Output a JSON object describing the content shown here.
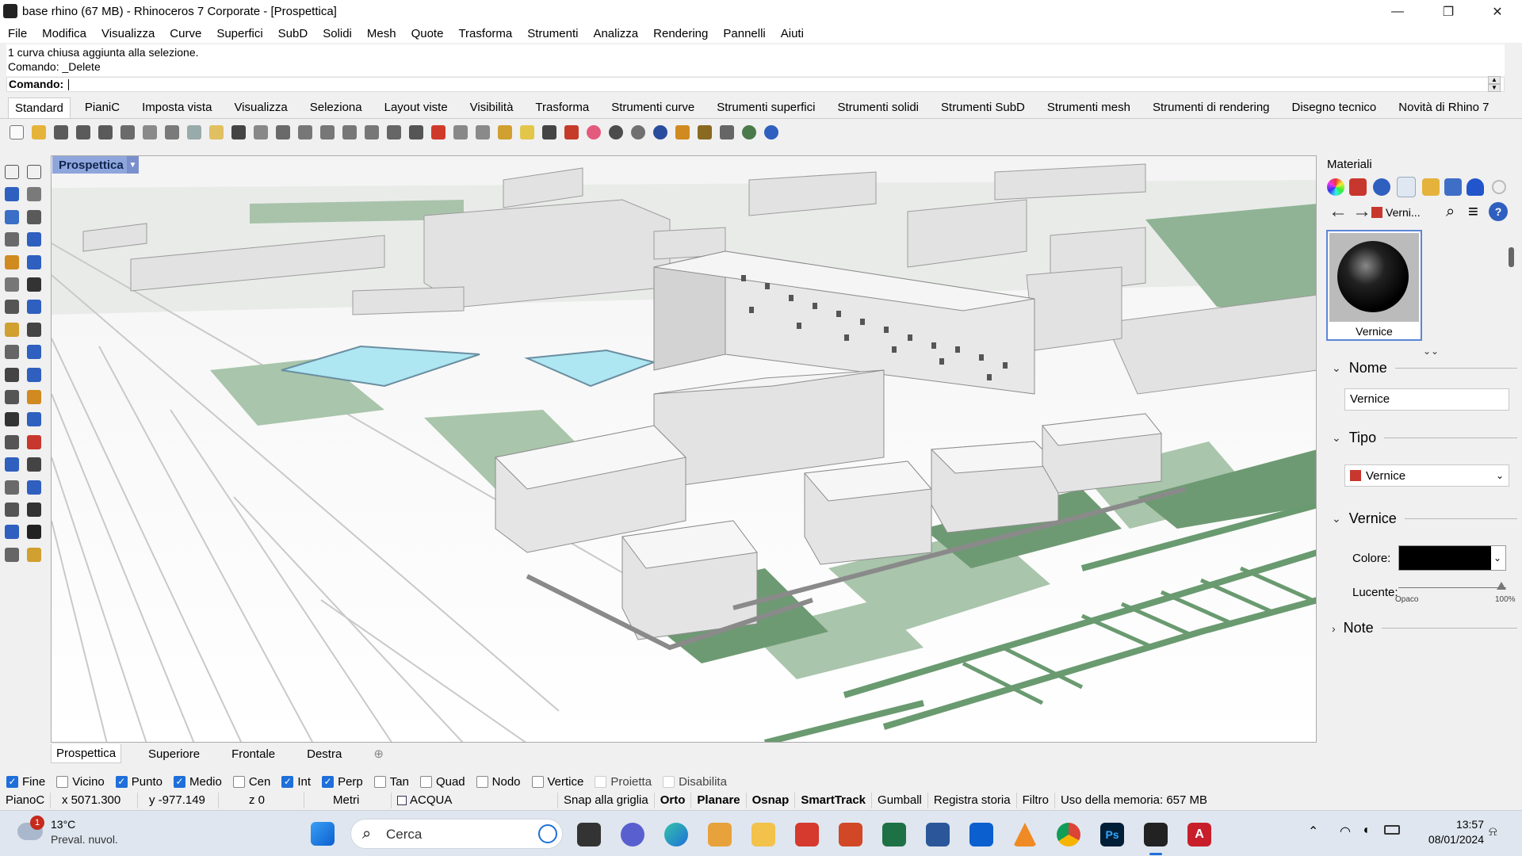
{
  "window": {
    "title": "base rhino (67 MB) - Rhinoceros 7 Corporate - [Prospettica]",
    "controls": {
      "minimize": "—",
      "maximize": "❐",
      "close": "✕"
    }
  },
  "menu": [
    "File",
    "Modifica",
    "Visualizza",
    "Curve",
    "Superfici",
    "SubD",
    "Solidi",
    "Mesh",
    "Quote",
    "Trasforma",
    "Strumenti",
    "Analizza",
    "Rendering",
    "Pannelli",
    "Aiuti"
  ],
  "command": {
    "history": [
      "1 curva chiusa aggiunta alla selezione.",
      "Comando: _Delete"
    ],
    "prompt": "Comando:"
  },
  "toolbar_tabs": [
    "Standard",
    "PianiC",
    "Imposta vista",
    "Visualizza",
    "Seleziona",
    "Layout viste",
    "Visibilità",
    "Trasforma",
    "Strumenti curve",
    "Strumenti superfici",
    "Strumenti solidi",
    "Strumenti SubD",
    "Strumenti mesh",
    "Strumenti di rendering",
    "Disegno tecnico",
    "Novità di Rhino 7"
  ],
  "toolbar_icons": [
    "new-icon",
    "open-icon",
    "save-icon",
    "save-as-icon",
    "save-small-icon",
    "print-icon",
    "copy-page-icon",
    "cut-icon",
    "copy-icon",
    "paste-icon",
    "undo-icon",
    "pan-icon",
    "move-view-icon",
    "zoom-icon",
    "zoom-window-icon",
    "zoom-extents-icon",
    "zoom-selected-icon",
    "rotate-view-icon",
    "four-views-icon",
    "car-icon",
    "camera-icon",
    "circle-icon",
    "grid-snap-icon",
    "light-icon",
    "lock-icon",
    "material-icon",
    "color-wheel-icon",
    "sphere-shaded-icon",
    "sphere-rendered-icon",
    "sphere-blue-icon",
    "tools-icon",
    "gear-options-icon",
    "transform-icon",
    "globe-icon",
    "help-icon"
  ],
  "toolbar_colors": [
    "#fafafa",
    "#e6b33a",
    "#5a5a5a",
    "#5a5a5a",
    "#5a5a5a",
    "#6b6b6b",
    "#8a8a8a",
    "#7a7a7a",
    "#9aa",
    "#e0c060",
    "#444",
    "#888",
    "#6a6a6a",
    "#777",
    "#777",
    "#777",
    "#777",
    "#666",
    "#555",
    "#d03a2a",
    "#888",
    "#8a8a8a",
    "#d0a030",
    "#e2c64a",
    "#444",
    "#c63a2a",
    "#e45a7c",
    "#4c4c4c",
    "#707070",
    "#2a4c9c",
    "#d08a20",
    "#8a6a20",
    "#666",
    "#4a7a4a",
    "#2f5fbf"
  ],
  "left_tools": [
    "select-icon",
    "point-icon",
    "polyline-icon",
    "curve-icon",
    "circle-tool-icon",
    "ellipse-icon",
    "polygon-icon",
    "rectangle-icon",
    "arc-icon",
    "fillet-icon",
    "surface-icon",
    "extrude-icon",
    "box-icon",
    "boolean-icon",
    "cylinder-icon",
    "cap-icon",
    "mesh-icon",
    "light-tool-icon",
    "transform-tool-icon",
    "align-icon",
    "analyze-icon",
    "group-icon",
    "fillet-curve-icon",
    "offset-icon",
    "text-icon",
    "dimension-icon",
    "block-icon",
    "edit-icon",
    "render-icon",
    "section-icon",
    "array-icon",
    "block-edit-icon",
    "scale-icon",
    "check-icon",
    "material-tool-icon",
    "paint-icon"
  ],
  "viewport": {
    "label": "Prospettica",
    "tabs": [
      "Prospettica",
      "Superiore",
      "Frontale",
      "Destra"
    ],
    "add_tab": "⊕"
  },
  "osnaps": [
    {
      "label": "Fine",
      "state": "on"
    },
    {
      "label": "Vicino",
      "state": "off"
    },
    {
      "label": "Punto",
      "state": "on"
    },
    {
      "label": "Medio",
      "state": "on"
    },
    {
      "label": "Cen",
      "state": "off"
    },
    {
      "label": "Int",
      "state": "on"
    },
    {
      "label": "Perp",
      "state": "on"
    },
    {
      "label": "Tan",
      "state": "off"
    },
    {
      "label": "Quad",
      "state": "off"
    },
    {
      "label": "Nodo",
      "state": "off"
    },
    {
      "label": "Vertice",
      "state": "off"
    },
    {
      "label": "Proietta",
      "state": "disabled"
    },
    {
      "label": "Disabilita",
      "state": "disabled"
    }
  ],
  "status": {
    "cplane": "PianoC",
    "x": "x 5071.300",
    "y": "y -977.149",
    "z": "z 0",
    "units": "Metri",
    "layer": "ACQUA",
    "grid_snap": "Snap alla griglia",
    "ortho": "Orto",
    "planar": "Planare",
    "osnap": "Osnap",
    "smarttrack": "SmartTrack",
    "gumball": "Gumball",
    "history": "Registra storia",
    "filter": "Filtro",
    "memory": "Uso della memoria: 657 MB"
  },
  "panel": {
    "title": "Materiali",
    "breadcrumb": "Verni...",
    "material_name": "Vernice",
    "sections": {
      "name": "Nome",
      "type": "Tipo",
      "paint": "Vernice",
      "notes": "Note"
    },
    "name_value": "Vernice",
    "type_value": "Vernice",
    "color_label": "Colore:",
    "color_value": "#000000",
    "gloss_label": "Lucente:",
    "gloss_min": "Opaco",
    "gloss_max": "100%",
    "gloss_level": 1.0
  },
  "taskbar": {
    "weather_temp": "13°C",
    "weather_text": "Preval. nuvol.",
    "weather_badge": "1",
    "search_placeholder": "Cerca",
    "time": "13:57",
    "date": "08/01/2024"
  }
}
